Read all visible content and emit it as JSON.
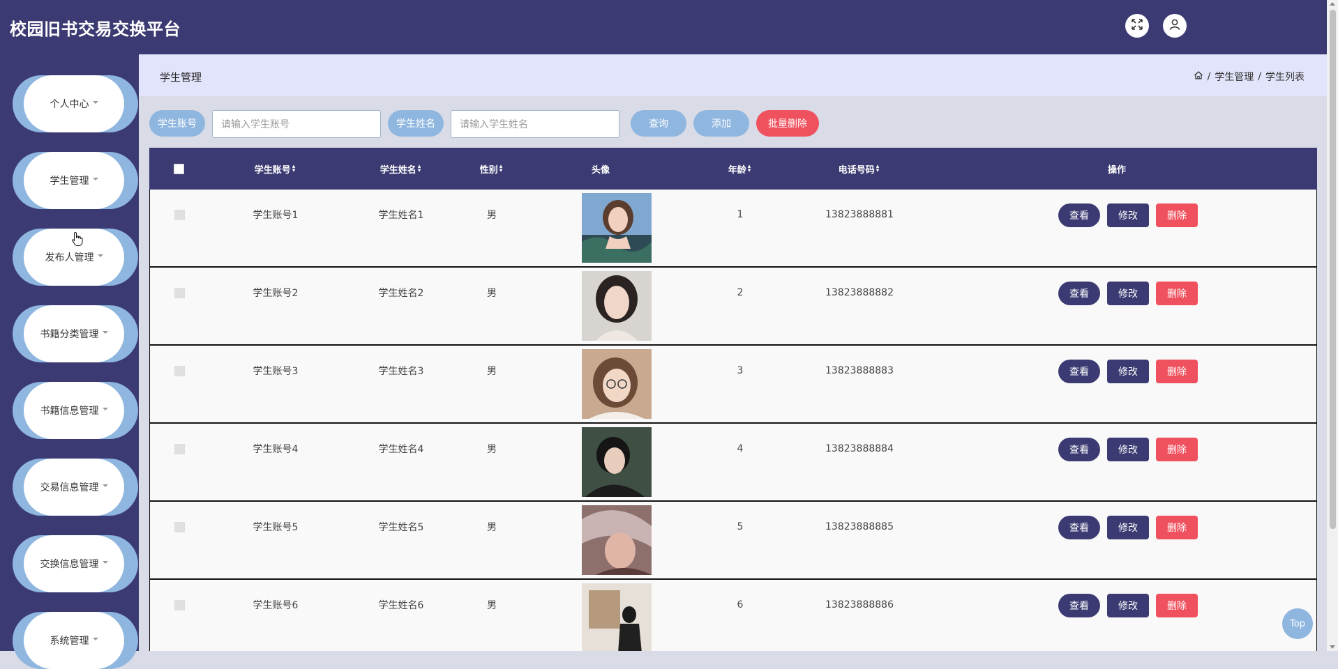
{
  "header": {
    "app_title": "校园旧书交易交换平台",
    "icons": [
      "fullscreen-icon",
      "user-icon"
    ]
  },
  "sidebar": {
    "items": [
      {
        "label": "个人中心"
      },
      {
        "label": "学生管理"
      },
      {
        "label": "发布人管理"
      },
      {
        "label": "书籍分类管理"
      },
      {
        "label": "书籍信息管理"
      },
      {
        "label": "交易信息管理"
      },
      {
        "label": "交换信息管理"
      },
      {
        "label": "系统管理"
      }
    ]
  },
  "breadcrumb": {
    "page_title": "学生管理",
    "home_icon": "home-icon",
    "items": [
      "学生管理",
      "学生列表"
    ],
    "separator": "/"
  },
  "search": {
    "account_label": "学生账号",
    "account_placeholder": "请输入学生账号",
    "name_label": "学生姓名",
    "name_placeholder": "请输入学生姓名",
    "query_button": "查询",
    "add_button": "添加",
    "batch_delete_button": "批量删除"
  },
  "table": {
    "columns": [
      "学生账号",
      "学生姓名",
      "性别",
      "头像",
      "年龄",
      "电话号码",
      "操作"
    ],
    "rows": [
      {
        "account": "学生账号1",
        "name": "学生姓名1",
        "gender": "男",
        "age": "1",
        "phone": "13823888881"
      },
      {
        "account": "学生账号2",
        "name": "学生姓名2",
        "gender": "男",
        "age": "2",
        "phone": "13823888882"
      },
      {
        "account": "学生账号3",
        "name": "学生姓名3",
        "gender": "男",
        "age": "3",
        "phone": "13823888883"
      },
      {
        "account": "学生账号4",
        "name": "学生姓名4",
        "gender": "男",
        "age": "4",
        "phone": "13823888884"
      },
      {
        "account": "学生账号5",
        "name": "学生姓名5",
        "gender": "男",
        "age": "5",
        "phone": "13823888885"
      },
      {
        "account": "学生账号6",
        "name": "学生姓名6",
        "gender": "男",
        "age": "6",
        "phone": "13823888886"
      }
    ],
    "actions": {
      "view": "查看",
      "edit": "修改",
      "delete": "删除"
    }
  },
  "back_to_top": "Top",
  "colors": {
    "primary": "#3b3a72",
    "accent": "#8fb6df",
    "danger": "#f0515e"
  }
}
